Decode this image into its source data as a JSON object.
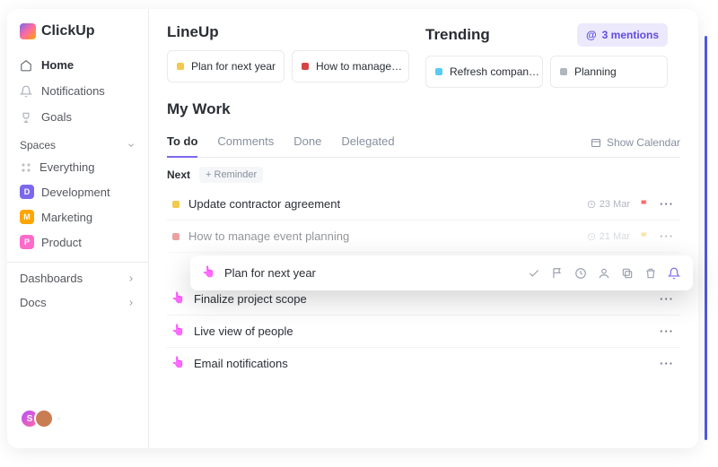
{
  "brand": {
    "name": "ClickUp"
  },
  "sidebar": {
    "nav": [
      {
        "label": "Home"
      },
      {
        "label": "Notifications"
      },
      {
        "label": "Goals"
      }
    ],
    "spaces_header": "Spaces",
    "everything": "Everything",
    "spaces": [
      {
        "letter": "D",
        "label": "Development",
        "color": "#7b68ee"
      },
      {
        "letter": "M",
        "label": "Marketing",
        "color": "#ffa500"
      },
      {
        "letter": "P",
        "label": "Product",
        "color": "#ff6bcb"
      }
    ],
    "dashboards": "Dashboards",
    "docs": "Docs",
    "avatars": [
      {
        "initial": "S",
        "bg": "linear-gradient(135deg,#b84dff,#ff6b9d)"
      },
      {
        "initial": "",
        "bg": "#c97d52"
      }
    ]
  },
  "header": {
    "lineup_title": "LineUp",
    "trending_title": "Trending",
    "mentions": "3 mentions",
    "lineup_cards": [
      {
        "label": "Plan for next year",
        "color": "#f2c94c"
      },
      {
        "label": "How to manage…",
        "color": "#d64545"
      }
    ],
    "trending_cards": [
      {
        "label": "Refresh compan…",
        "color": "#56ccf2"
      },
      {
        "label": "Planning",
        "color": "#b0b6be"
      }
    ]
  },
  "my_work": {
    "title": "My Work",
    "tabs": [
      "To do",
      "Comments",
      "Done",
      "Delegated"
    ],
    "show_calendar": "Show Calendar",
    "next": "Next",
    "reminder": "+ Reminder",
    "tasks": [
      {
        "title": "Update contractor agreement",
        "date": "23 Mar",
        "color": "#f2c94c",
        "flag": "#ff6b6b"
      },
      {
        "title": "How to manage event planning",
        "date": "21 Mar",
        "color": "#d64545",
        "flag": "#f2c94c"
      },
      {
        "title": "Finalize project scope",
        "date": "",
        "color": "",
        "flag": ""
      },
      {
        "title": "Live view of people",
        "date": "",
        "color": "",
        "flag": ""
      },
      {
        "title": "Email notifications",
        "date": "",
        "color": "",
        "flag": ""
      }
    ]
  },
  "floating": {
    "title": "Plan for next year"
  }
}
